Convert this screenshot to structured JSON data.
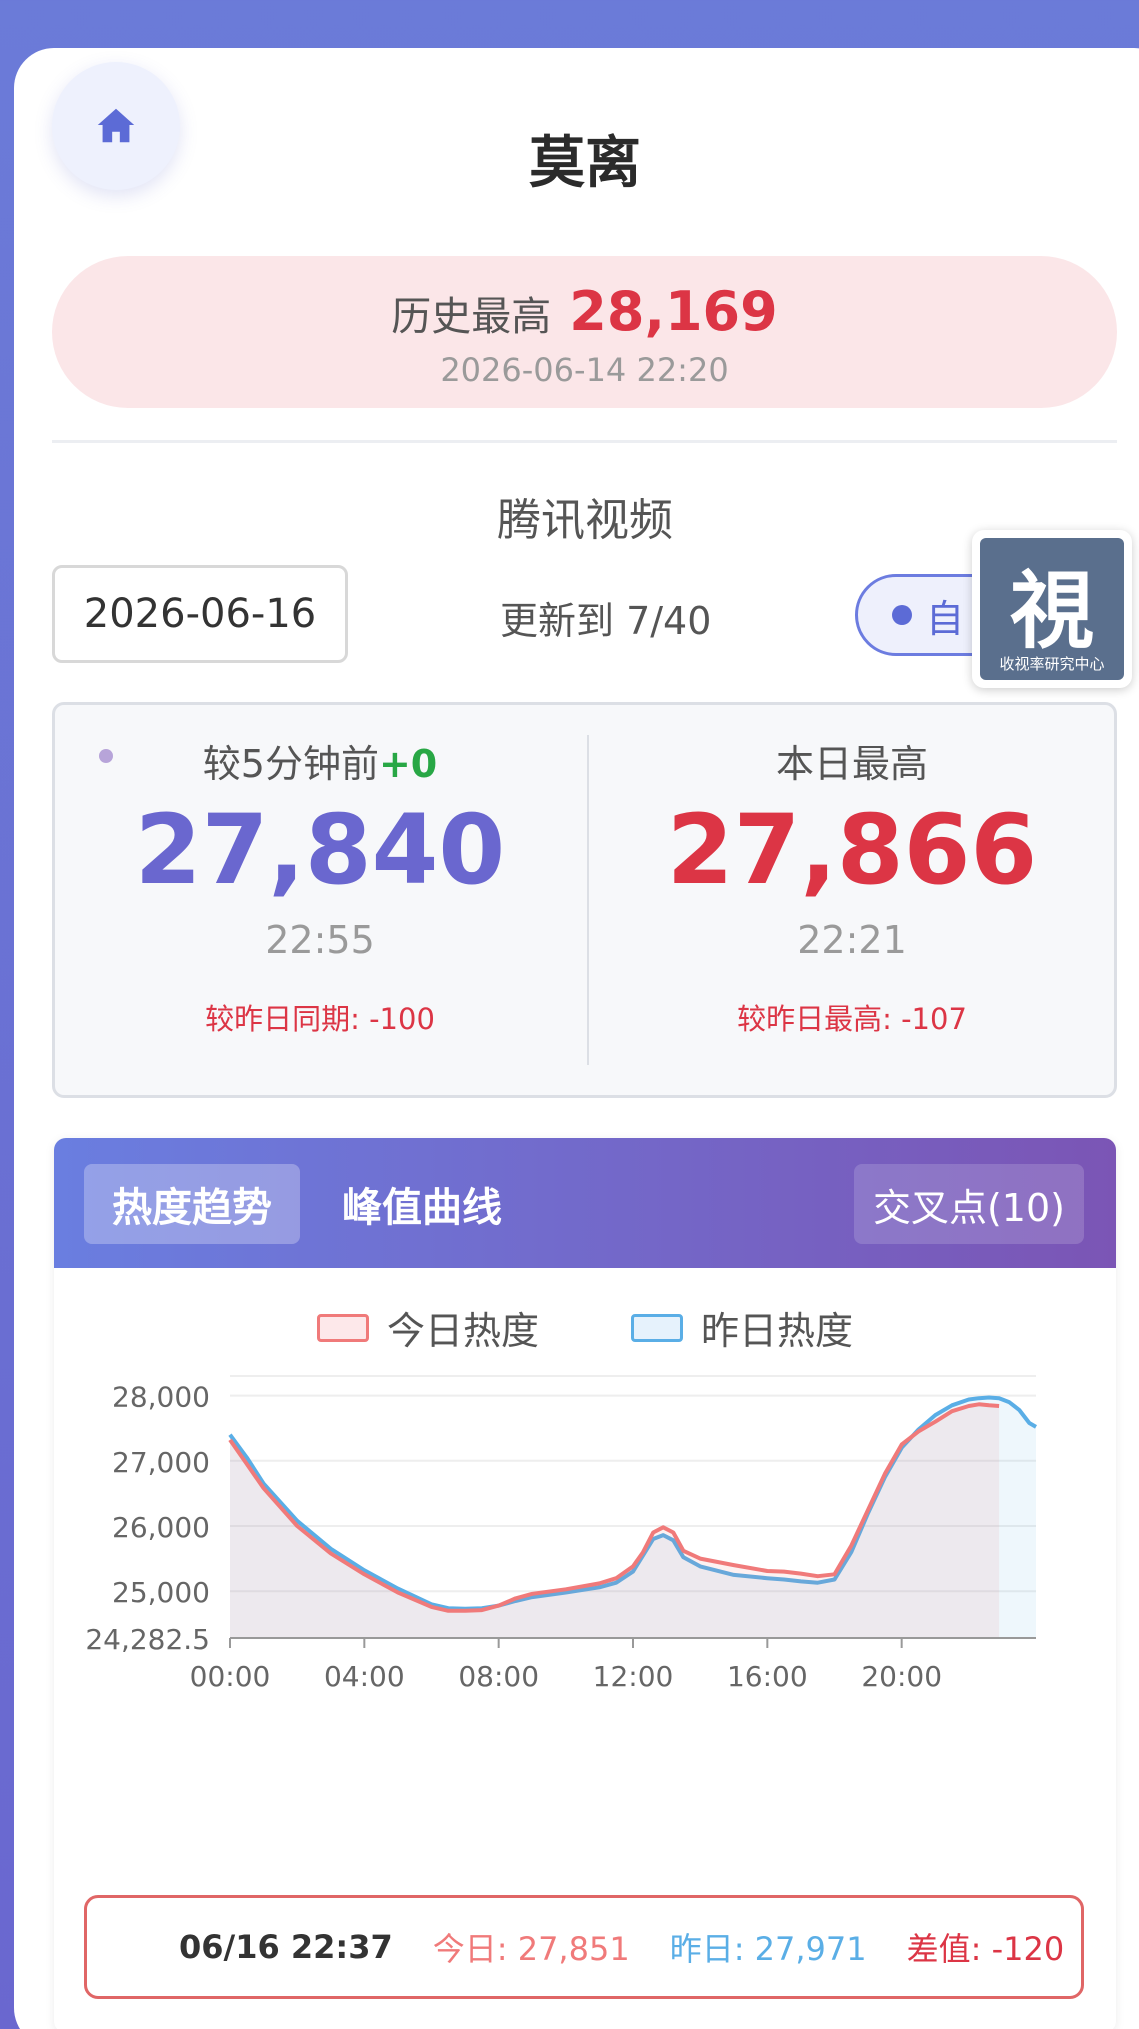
{
  "page": {
    "title": "莫离"
  },
  "record": {
    "label": "历史最高",
    "value": "28,169",
    "time": "2026-06-14 22:20"
  },
  "platform": "腾讯视频",
  "controls": {
    "date": "2026-06-16",
    "update_text": "更新到 7/40",
    "auto_label": "自"
  },
  "badge": {
    "char": "視",
    "caption": "收视率研究中心"
  },
  "current": {
    "label": "较5分钟前",
    "delta": "+0",
    "value": "27,840",
    "time": "22:55",
    "compare": "较昨日同期: -100"
  },
  "peak": {
    "label": "本日最高",
    "value": "27,866",
    "time": "22:21",
    "compare": "较昨日最高: -107"
  },
  "tabs": {
    "trend": "热度趋势",
    "peak_curve": "峰值曲线",
    "cross": "交叉点(10)"
  },
  "legend": {
    "today": "今日热度",
    "yesterday": "昨日热度"
  },
  "colors": {
    "today": "#f07a7a",
    "yesterday": "#5aaee6",
    "accent": "#6a67cf",
    "red": "#dc3545"
  },
  "tooltip": {
    "time": "06/16 22:37",
    "today": "今日: 27,851",
    "yesterday": "昨日: 27,971",
    "diff": "差值: -120"
  },
  "chart_data": {
    "type": "line",
    "x_ticks": [
      "00:00",
      "04:00",
      "08:00",
      "12:00",
      "16:00",
      "20:00"
    ],
    "y_ticks": [
      "24,282.5",
      "25,000",
      "26,000",
      "27,000",
      "28,000"
    ],
    "y_tick_values": [
      24282.5,
      25000,
      26000,
      27000,
      28000
    ],
    "ylim": [
      24282.5,
      28300
    ],
    "xlim_hours": [
      0,
      24
    ],
    "series": [
      {
        "name": "今日热度",
        "color": "#f07a7a",
        "fill": true,
        "x_hours": [
          0,
          0.5,
          1,
          2,
          3,
          4,
          5,
          6,
          6.5,
          7,
          7.5,
          8,
          8.5,
          9,
          10,
          11,
          11.5,
          12,
          12.3,
          12.6,
          12.9,
          13.2,
          13.5,
          14,
          15,
          16,
          16.5,
          17,
          17.5,
          18,
          18.5,
          19,
          19.5,
          20,
          20.5,
          21,
          21.5,
          22,
          22.3,
          22.6,
          22.9
        ],
        "values": [
          27320,
          26950,
          26580,
          26000,
          25580,
          25260,
          24980,
          24760,
          24700,
          24700,
          24710,
          24780,
          24890,
          24960,
          25030,
          25120,
          25200,
          25380,
          25600,
          25900,
          25980,
          25900,
          25620,
          25500,
          25400,
          25310,
          25300,
          25270,
          25230,
          25260,
          25700,
          26250,
          26800,
          27250,
          27450,
          27600,
          27760,
          27840,
          27866,
          27851,
          27840
        ]
      },
      {
        "name": "昨日热度",
        "color": "#5aaee6",
        "fill": true,
        "x_hours": [
          0,
          0.5,
          1,
          2,
          3,
          4,
          5,
          6,
          6.5,
          7,
          7.5,
          8,
          8.5,
          9,
          10,
          11,
          11.5,
          12,
          12.3,
          12.6,
          12.9,
          13.2,
          13.5,
          14,
          15,
          16,
          16.5,
          17,
          17.5,
          18,
          18.5,
          19,
          19.5,
          20,
          20.5,
          21,
          21.5,
          22,
          22.3,
          22.6,
          22.9,
          23.2,
          23.5,
          23.8,
          24
        ],
        "values": [
          27400,
          27050,
          26650,
          26080,
          25650,
          25320,
          25040,
          24800,
          24740,
          24730,
          24740,
          24780,
          24850,
          24910,
          24980,
          25060,
          25130,
          25300,
          25550,
          25800,
          25860,
          25780,
          25520,
          25380,
          25250,
          25200,
          25180,
          25150,
          25130,
          25180,
          25600,
          26200,
          26750,
          27200,
          27480,
          27700,
          27850,
          27940,
          27960,
          27971,
          27960,
          27900,
          27780,
          27580,
          27520
        ]
      }
    ]
  }
}
